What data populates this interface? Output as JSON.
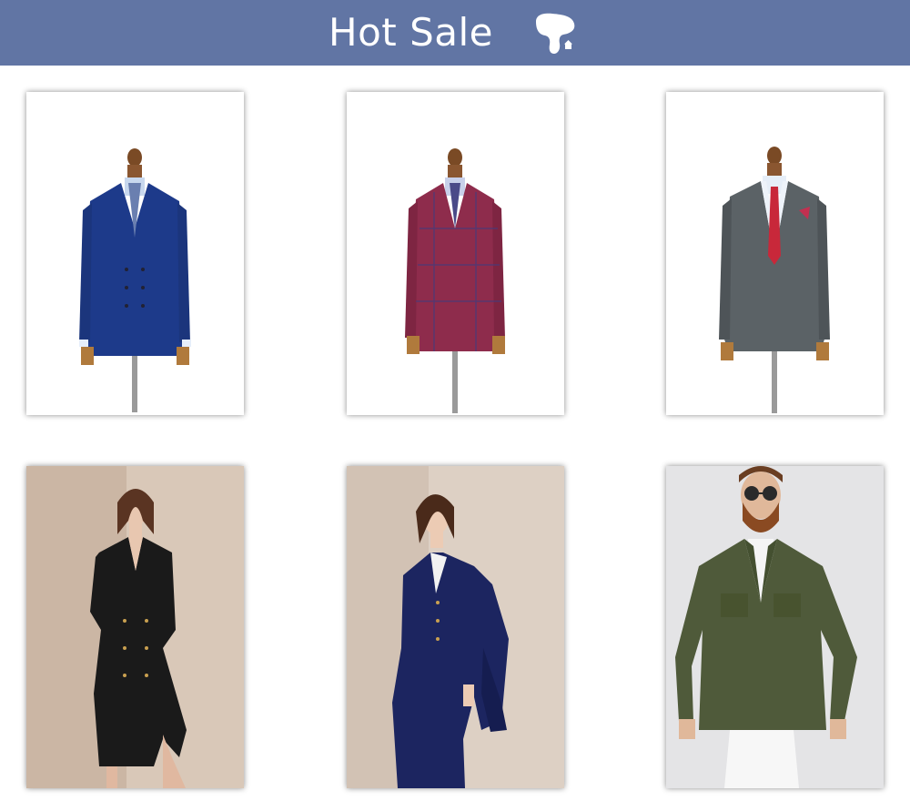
{
  "header": {
    "title": "Hot Sale",
    "logo_icon": "brand-logo-icon",
    "background_color": "#6175a4"
  },
  "products": [
    {
      "image": "navy-double-breasted-suit-on-mannequin",
      "color": "#1d3a8a"
    },
    {
      "image": "burgundy-windowpane-double-breasted-suit-on-mannequin",
      "color": "#8e2c4c"
    },
    {
      "image": "grey-check-suit-with-red-tie-on-mannequin",
      "color": "#5b6266"
    },
    {
      "image": "woman-black-double-breasted-coat-dress",
      "color": "#1a1a1a"
    },
    {
      "image": "woman-navy-three-piece-suit",
      "color": "#1c2560"
    },
    {
      "image": "man-olive-field-jacket-sunglasses",
      "color": "#4f5a3a"
    }
  ]
}
